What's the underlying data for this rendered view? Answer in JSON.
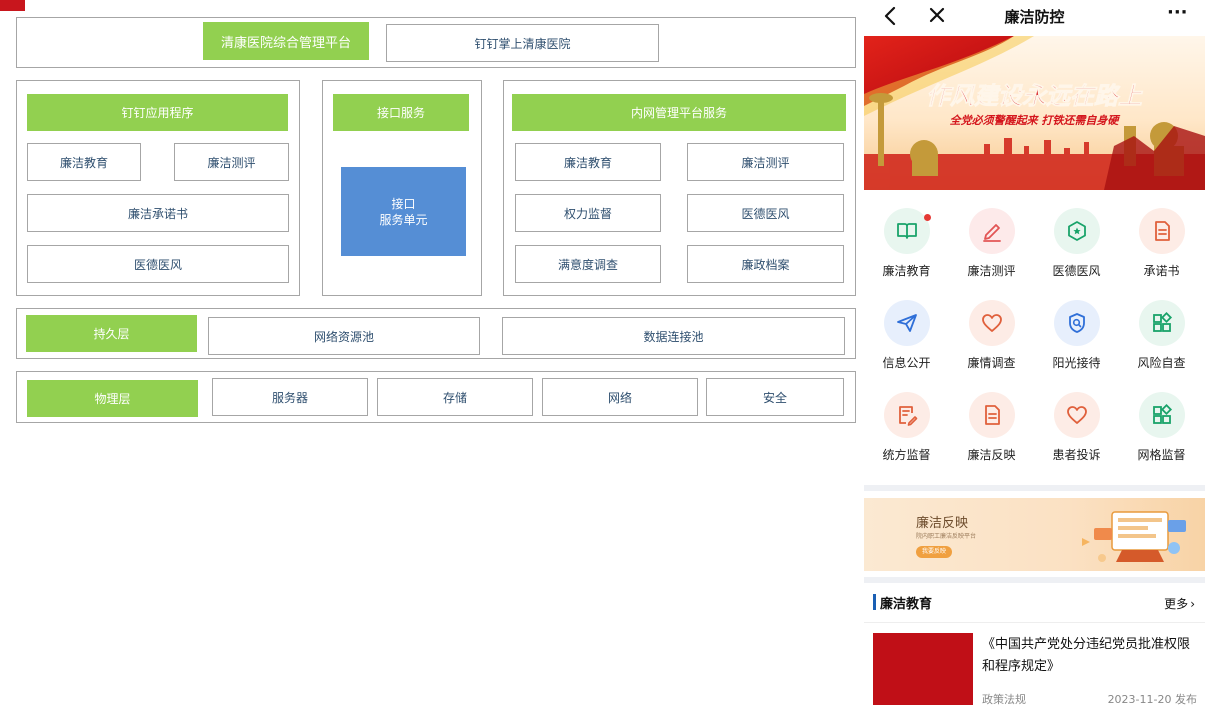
{
  "diagram": {
    "top_title": "清康医院综合管理平台",
    "top_app": "钉钉掌上清康医院",
    "dingtalk": {
      "header": "钉钉应用程序",
      "items": [
        "廉洁教育",
        "廉洁测评",
        "廉洁承诺书",
        "医德医风"
      ]
    },
    "interface": {
      "header": "接口服务",
      "unit_line1": "接口",
      "unit_line2": "服务单元"
    },
    "intranet": {
      "header": "内网管理平台服务",
      "items": [
        "廉洁教育",
        "廉洁测评",
        "权力监督",
        "医德医风",
        "满意度调查",
        "廉政档案"
      ]
    },
    "persistence": {
      "header": "持久层",
      "items": [
        "网络资源池",
        "数据连接池"
      ]
    },
    "physical": {
      "header": "物理层",
      "items": [
        "服务器",
        "存储",
        "网络",
        "安全"
      ]
    }
  },
  "phone": {
    "title": "廉洁防控",
    "nav": {
      "back": "chevron-left-icon",
      "close": "close-icon",
      "more_symbol": "···"
    },
    "banner": {
      "headline": "作风建设永远在路上",
      "subline": "全党必须警醒起来 打铁还需自身硬"
    },
    "grid": [
      {
        "label": "廉洁教育",
        "icon": "book-icon",
        "color": "#19a36a",
        "bg": "#e8f6ef",
        "badge": true
      },
      {
        "label": "廉洁测评",
        "icon": "pen-icon",
        "color": "#e25555",
        "bg": "#fdeaea",
        "badge": false
      },
      {
        "label": "医德医风",
        "icon": "shield-star-icon",
        "color": "#19a36a",
        "bg": "#e8f6ef",
        "badge": false
      },
      {
        "label": "承诺书",
        "icon": "document-icon",
        "color": "#e0603c",
        "bg": "#fdece6",
        "badge": false
      },
      {
        "label": "信息公开",
        "icon": "paper-plane-icon",
        "color": "#2f6fd8",
        "bg": "#e7effc",
        "badge": false
      },
      {
        "label": "廉情调查",
        "icon": "heart-icon",
        "color": "#e0603c",
        "bg": "#fdece6",
        "badge": false
      },
      {
        "label": "阳光接待",
        "icon": "search-shield-icon",
        "color": "#2f6fd8",
        "bg": "#e7effc",
        "badge": false
      },
      {
        "label": "风险自查",
        "icon": "apps-icon",
        "color": "#19a36a",
        "bg": "#e8f6ef",
        "badge": false
      },
      {
        "label": "统方监督",
        "icon": "edit-document-icon",
        "color": "#e0603c",
        "bg": "#fdece6",
        "badge": false
      },
      {
        "label": "廉洁反映",
        "icon": "document-icon",
        "color": "#e0603c",
        "bg": "#fdece6",
        "badge": false
      },
      {
        "label": "患者投诉",
        "icon": "heart-icon",
        "color": "#e0603c",
        "bg": "#fdece6",
        "badge": false
      },
      {
        "label": "网格监督",
        "icon": "apps-icon",
        "color": "#19a36a",
        "bg": "#e8f6ef",
        "badge": false
      }
    ],
    "promo": {
      "title": "廉洁反映",
      "subtitle": "院内职工廉洁反映平台",
      "button": "我要反映"
    },
    "section": {
      "title": "廉洁教育",
      "more": "更多",
      "more_arrow": "›"
    },
    "article": {
      "title": "《中国共产党处分违纪党员批准权限和程序规定》",
      "category": "政策法规",
      "date": "2023-11-20 发布"
    }
  }
}
